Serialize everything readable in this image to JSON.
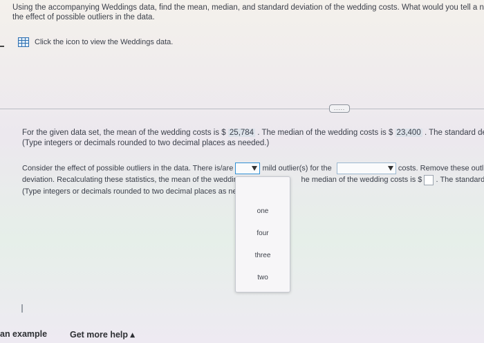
{
  "question": {
    "line1": "Using the accompanying Weddings data, find the mean, median, and standard deviation of the wedding costs. What would you tell a ne",
    "line2": "the effect of possible outliers in the data."
  },
  "data_link": {
    "label": "Click the icon to view the Weddings data."
  },
  "expand_button": {
    "label": "....."
  },
  "part1": {
    "text_a": "For the given data set, the mean of the wedding costs is $",
    "mean": "25,784",
    "text_b": ". The median of the wedding costs is $",
    "median": "23,400",
    "text_c": ". The standard deviatior",
    "note": "(Type integers or decimals rounded to two decimal places as needed.)"
  },
  "part2": {
    "text_a": "Consider the effect of possible outliers in the data. There is/are",
    "text_b": "mild outlier(s) for the",
    "text_c": "costs. Remove these outli",
    "line2_a": "deviation. Recalculating these statistics, the mean of the weddir",
    "line2_b": "he median of the wedding costs is $",
    "line2_c": ". The standard d",
    "note": "(Type integers or decimals rounded to two decimal places as ne"
  },
  "dropdown_options": [
    "one",
    "four",
    "three",
    "two"
  ],
  "footer": {
    "example": "an example",
    "help": "Get more help ▴"
  }
}
